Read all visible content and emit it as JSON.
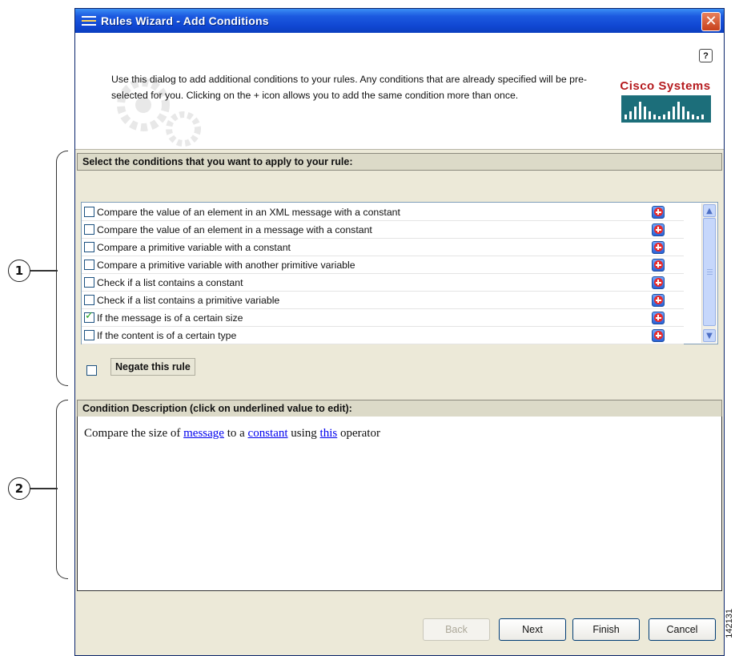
{
  "window": {
    "title": "Rules Wizard - Add Conditions",
    "close_label": "✕"
  },
  "header": {
    "description": "Use this dialog to add additional conditions to your rules. Any conditions that are already specified will be pre-selected for you. Clicking on the + icon allows you to add the same condition more than once.",
    "help_label": "?",
    "logo_text": "Cisco Systems"
  },
  "conditions": {
    "title": "Select the conditions that you want to apply to your rule:",
    "items": [
      {
        "label": "Compare the value of an element in an XML message with a constant",
        "checked": false
      },
      {
        "label": "Compare the value of an element in a message with a constant",
        "checked": false
      },
      {
        "label": "Compare a primitive variable with a constant",
        "checked": false
      },
      {
        "label": "Compare a primitive variable with another primitive variable",
        "checked": false
      },
      {
        "label": "Check if a list contains a constant",
        "checked": false
      },
      {
        "label": "Check if a list contains a primitive variable",
        "checked": false
      },
      {
        "label": "If the message is of a certain size",
        "checked": true
      },
      {
        "label": "If the content is of a certain type",
        "checked": false
      }
    ],
    "negate_label": "Negate this rule",
    "negate_checked": false
  },
  "description": {
    "title": "Condition Description (click on underlined value to edit):",
    "part1": "Compare the size of ",
    "link1": "message",
    "part2": " to a ",
    "link2": "constant",
    "part3": " using ",
    "link3": "this",
    "part4": " operator"
  },
  "buttons": {
    "back": "Back",
    "next": "Next",
    "finish": "Finish",
    "cancel": "Cancel"
  },
  "callouts": {
    "one": "1",
    "two": "2"
  },
  "figure_number": "142131",
  "colors": {
    "titlebar": "#1148d3",
    "logo_red": "#b51a1e",
    "link": "#0000ee"
  }
}
